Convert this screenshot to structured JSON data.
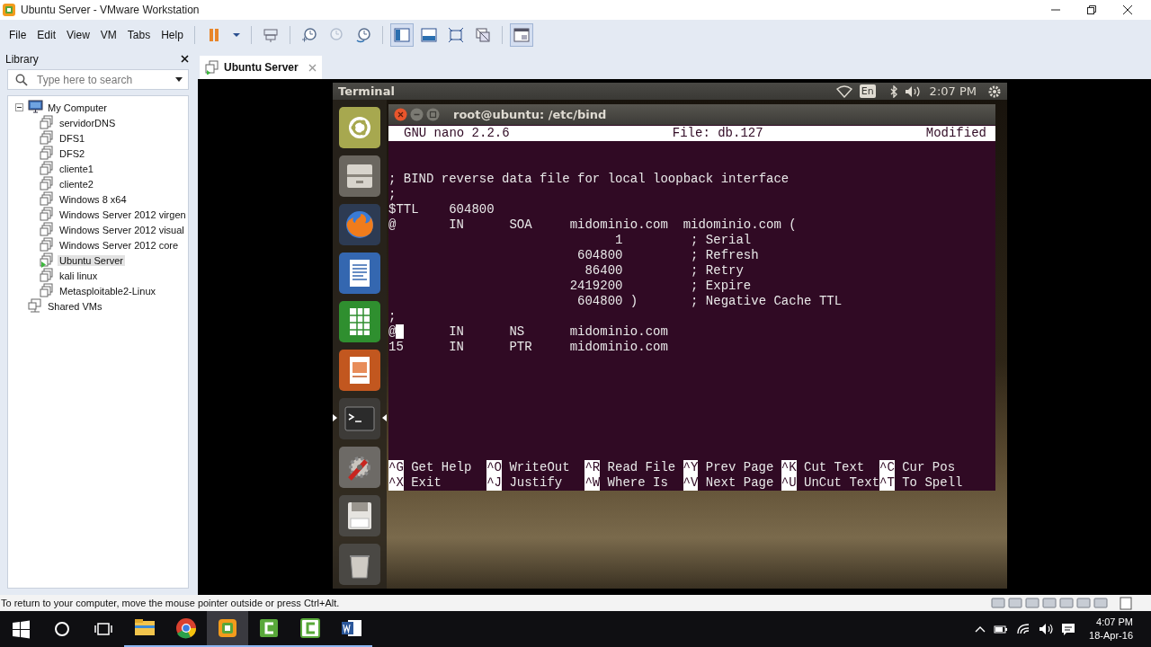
{
  "window": {
    "title": "Ubuntu Server - VMware Workstation"
  },
  "menu": [
    {
      "label": "File"
    },
    {
      "label": "Edit"
    },
    {
      "label": "View"
    },
    {
      "label": "VM"
    },
    {
      "label": "Tabs"
    },
    {
      "label": "Help"
    }
  ],
  "toolbar": [
    {
      "kind": "pause",
      "pressed": false,
      "disabled": false
    },
    {
      "kind": "caret",
      "pressed": false,
      "disabled": false
    },
    {
      "kind": "send-keys",
      "pressed": false,
      "disabled": false
    },
    {
      "kind": "snapshot-take",
      "pressed": false,
      "disabled": false
    },
    {
      "kind": "snapshot-revert",
      "pressed": false,
      "disabled": true
    },
    {
      "kind": "snapshot-manager",
      "pressed": false,
      "disabled": false
    },
    {
      "kind": "library-view",
      "pressed": true,
      "disabled": false
    },
    {
      "kind": "thumbnail-view",
      "pressed": false,
      "disabled": false
    },
    {
      "kind": "fullscreen",
      "pressed": false,
      "disabled": false
    },
    {
      "kind": "unity",
      "pressed": false,
      "disabled": false
    },
    {
      "kind": "console-view",
      "pressed": true,
      "disabled": false
    }
  ],
  "library": {
    "title": "Library",
    "search": {
      "placeholder": "Type here to search"
    },
    "tree": [
      {
        "label": "My Computer",
        "kind": "computer",
        "selected": false,
        "expanded": true,
        "children": [
          {
            "label": "servidorDNS",
            "kind": "vm",
            "selected": false,
            "running": false
          },
          {
            "label": "DFS1",
            "kind": "vm",
            "selected": false,
            "running": false
          },
          {
            "label": "DFS2",
            "kind": "vm",
            "selected": false,
            "running": false
          },
          {
            "label": "cliente1",
            "kind": "vm",
            "selected": false,
            "running": false
          },
          {
            "label": "cliente2",
            "kind": "vm",
            "selected": false,
            "running": false
          },
          {
            "label": "Windows 8 x64",
            "kind": "vm",
            "selected": false,
            "running": false
          },
          {
            "label": "Windows Server 2012 virgen",
            "kind": "vm",
            "selected": false,
            "running": false
          },
          {
            "label": "Windows Server 2012 visual",
            "kind": "vm",
            "selected": false,
            "running": false
          },
          {
            "label": "Windows Server 2012 core",
            "kind": "vm",
            "selected": false,
            "running": false
          },
          {
            "label": "Ubuntu Server",
            "kind": "vm",
            "selected": true,
            "running": true
          },
          {
            "label": "kali linux",
            "kind": "vm",
            "selected": false,
            "running": false
          },
          {
            "label": "Metasploitable2-Linux",
            "kind": "vm",
            "selected": false,
            "running": false
          }
        ]
      },
      {
        "label": "Shared VMs",
        "kind": "shared",
        "selected": false
      }
    ]
  },
  "tabs": [
    {
      "label": "Ubuntu Server",
      "selected": true
    }
  ],
  "guest": {
    "panel": {
      "app_title": "Terminal",
      "keyboard": "En",
      "clock": "2:07 PM"
    },
    "launcher": [
      {
        "kind": "ubuntu",
        "active": false
      },
      {
        "kind": "files",
        "active": false
      },
      {
        "kind": "firefox",
        "active": false
      },
      {
        "kind": "writer",
        "active": false
      },
      {
        "kind": "calc",
        "active": false
      },
      {
        "kind": "impress",
        "active": false
      },
      {
        "kind": "terminal",
        "active": true
      },
      {
        "kind": "settings",
        "active": false
      },
      {
        "kind": "disk",
        "active": false
      },
      {
        "kind": "trash",
        "active": false
      }
    ],
    "terminal": {
      "title": "root@ubuntu: /etc/bind",
      "nano": {
        "version": "GNU nano 2.2.6",
        "file": "File: db.127",
        "status": "Modified",
        "lines": [
          {
            "text": "; BIND reverse data file for local loopback interface",
            "cursor": false
          },
          {
            "text": ";",
            "cursor": false
          },
          {
            "text": "$TTL    604800",
            "cursor": false
          },
          {
            "text": "@       IN      SOA     midominio.com  midominio.com (",
            "cursor": false
          },
          {
            "text": "                              1         ; Serial",
            "cursor": false
          },
          {
            "text": "                         604800         ; Refresh",
            "cursor": false
          },
          {
            "text": "                          86400         ; Retry",
            "cursor": false
          },
          {
            "text": "                        2419200         ; Expire",
            "cursor": false
          },
          {
            "text": "                         604800 )       ; Negative Cache TTL",
            "cursor": false
          },
          {
            "text": ";",
            "cursor": false
          },
          {
            "text": "@       IN      NS      midominio.com",
            "cursor": true
          },
          {
            "text": "15      IN      PTR     midominio.com",
            "cursor": false
          }
        ],
        "shortcuts": [
          {
            "key": "^G",
            "label": "Get Help"
          },
          {
            "key": "^O",
            "label": "WriteOut"
          },
          {
            "key": "^R",
            "label": "Read File"
          },
          {
            "key": "^Y",
            "label": "Prev Page"
          },
          {
            "key": "^K",
            "label": "Cut Text"
          },
          {
            "key": "^C",
            "label": "Cur Pos"
          },
          {
            "key": "^X",
            "label": "Exit"
          },
          {
            "key": "^J",
            "label": "Justify"
          },
          {
            "key": "^W",
            "label": "Where Is"
          },
          {
            "key": "^V",
            "label": "Next Page"
          },
          {
            "key": "^U",
            "label": "UnCut Text"
          },
          {
            "key": "^T",
            "label": "To Spell"
          }
        ]
      }
    }
  },
  "status_bar": {
    "message": "To return to your computer, move the mouse pointer outside or press Ctrl+Alt."
  },
  "taskbar": {
    "apps": [
      {
        "kind": "explorer",
        "active": false
      },
      {
        "kind": "chrome",
        "active": false
      },
      {
        "kind": "vmware",
        "active": true
      },
      {
        "kind": "camtasia-recorder",
        "active": false
      },
      {
        "kind": "camtasia-studio",
        "active": false
      },
      {
        "kind": "word",
        "active": false
      }
    ],
    "time": "4:07 PM",
    "date": "18-Apr-16"
  }
}
